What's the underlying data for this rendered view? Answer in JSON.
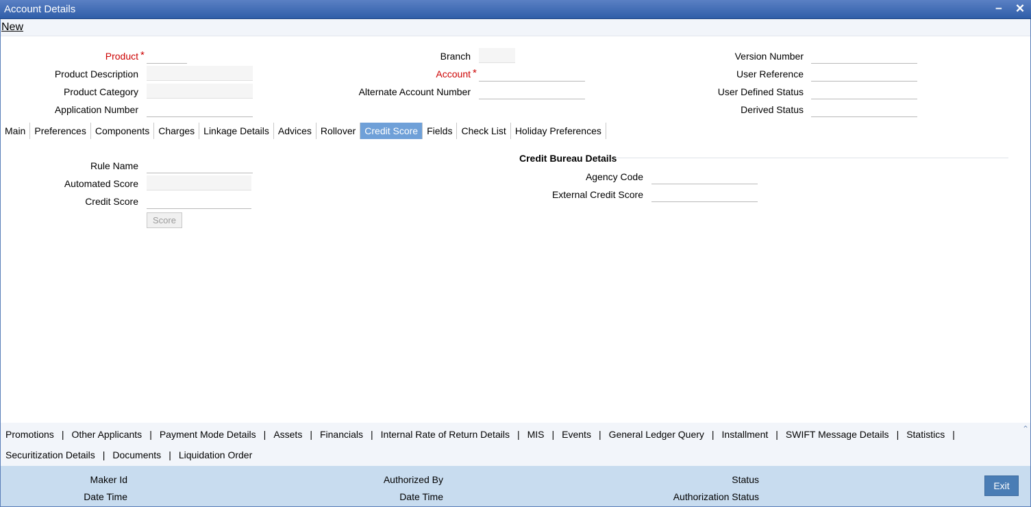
{
  "window": {
    "title": "Account Details",
    "minimize_icon": "minimize-icon",
    "close_icon": "close-icon"
  },
  "toolbar": {
    "new_label": "New"
  },
  "header": {
    "product_label": "Product",
    "product_description_label": "Product Description",
    "product_category_label": "Product Category",
    "application_number_label": "Application Number",
    "branch_label": "Branch",
    "account_label": "Account",
    "alternate_account_label": "Alternate Account Number",
    "version_number_label": "Version Number",
    "user_reference_label": "User Reference",
    "user_defined_status_label": "User Defined Status",
    "derived_status_label": "Derived Status",
    "required_mark": "*"
  },
  "tabs": [
    {
      "label": "Main"
    },
    {
      "label": "Preferences"
    },
    {
      "label": "Components"
    },
    {
      "label": "Charges"
    },
    {
      "label": "Linkage Details"
    },
    {
      "label": "Advices"
    },
    {
      "label": "Rollover"
    },
    {
      "label": "Credit Score",
      "active": true
    },
    {
      "label": "Fields"
    },
    {
      "label": "Check List"
    },
    {
      "label": "Holiday Preferences"
    }
  ],
  "credit_score": {
    "rule_name_label": "Rule Name",
    "automated_score_label": "Automated Score",
    "credit_score_label": "Credit Score",
    "score_button": "Score",
    "bureau_title": "Credit Bureau Details",
    "agency_code_label": "Agency Code",
    "external_credit_score_label": "External Credit Score"
  },
  "subsystems": {
    "row1": [
      "Promotions",
      "Other Applicants",
      "Payment Mode Details",
      "Assets",
      "Financials",
      "Internal Rate of Return Details",
      "MIS",
      "Events",
      "General Ledger Query",
      "Installment",
      "SWIFT Message Details",
      "Statistics"
    ],
    "row2": [
      "Securitization Details",
      "Documents",
      "Liquidation Order"
    ],
    "separator": "|",
    "scroll_icon": "chevron-up-icon"
  },
  "footer": {
    "maker_id_label": "Maker Id",
    "maker_date_time_label": "Date Time",
    "authorized_by_label": "Authorized By",
    "checker_date_time_label": "Date Time",
    "status_label": "Status",
    "authorization_status_label": "Authorization Status",
    "exit_button": "Exit"
  },
  "colors": {
    "title_bar": "#2f5ea8",
    "active_tab": "#6fa0d8",
    "footer": "#c8dcef",
    "required": "#cc0000",
    "exit_button": "#4a7db5"
  }
}
